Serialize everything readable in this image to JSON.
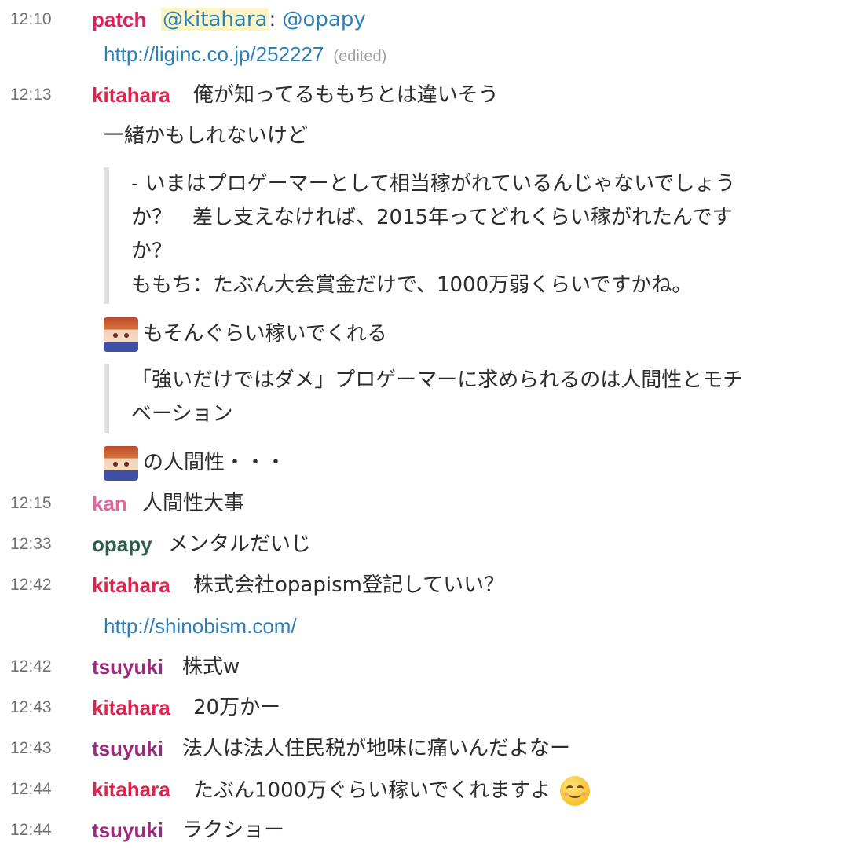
{
  "colors": {
    "patch": "#e01e5a",
    "kitahara": "#e0234e",
    "kan": "#e8659c",
    "opapy": "#2b5e4c",
    "tsuyuki": "#9b2a7e",
    "link": "#2a80b9"
  },
  "messages": [
    {
      "time": "12:10",
      "user": "patch",
      "mention": "@kitahara",
      "sep": ":",
      "mention2": "@opapy"
    },
    {
      "link": "http://liginc.co.jp/252227",
      "edited": "(edited)"
    },
    {
      "time": "12:13",
      "user": "kitahara",
      "text": "俺が知ってるももちとは違いそう"
    },
    {
      "text": "一緒かもしれないけど"
    },
    {
      "quote": [
        "- いまはプロゲーマーとして相当稼がれているんじゃないでしょう",
        "か？　差し支えなければ、2015年ってどれくらい稼がれたんです",
        "か？",
        "ももち：たぶん大会賞金だけで、1000万弱くらいですかね。"
      ]
    },
    {
      "emoji": "momochi-avatar-icon",
      "text": "もそんぐらい稼いでくれる"
    },
    {
      "quote": [
        "「強いだけではダメ」プロゲーマーに求められるのは人間性とモチ",
        "ベーション"
      ]
    },
    {
      "emoji": "momochi-avatar-icon",
      "text": "の人間性・・・"
    },
    {
      "time": "12:15",
      "user": "kan",
      "text": "人間性大事"
    },
    {
      "time": "12:33",
      "user": "opapy",
      "text": "メンタルだいじ"
    },
    {
      "time": "12:42",
      "user": "kitahara",
      "text": "株式会社opapism登記していい？"
    },
    {
      "link": "http://shinobism.com/"
    },
    {
      "time": "12:42",
      "user": "tsuyuki",
      "text": "株式w"
    },
    {
      "time": "12:43",
      "user": "kitahara",
      "text": "20万かー"
    },
    {
      "time": "12:43",
      "user": "tsuyuki",
      "text": "法人は法人住民税が地味に痛いんだよなー"
    },
    {
      "time": "12:44",
      "user": "kitahara",
      "text": "たぶん1000万ぐらい稼いでくれますよ",
      "emoji": "smile-emoji-icon"
    },
    {
      "time": "12:44",
      "user": "tsuyuki",
      "text": "ラクショー"
    }
  ]
}
